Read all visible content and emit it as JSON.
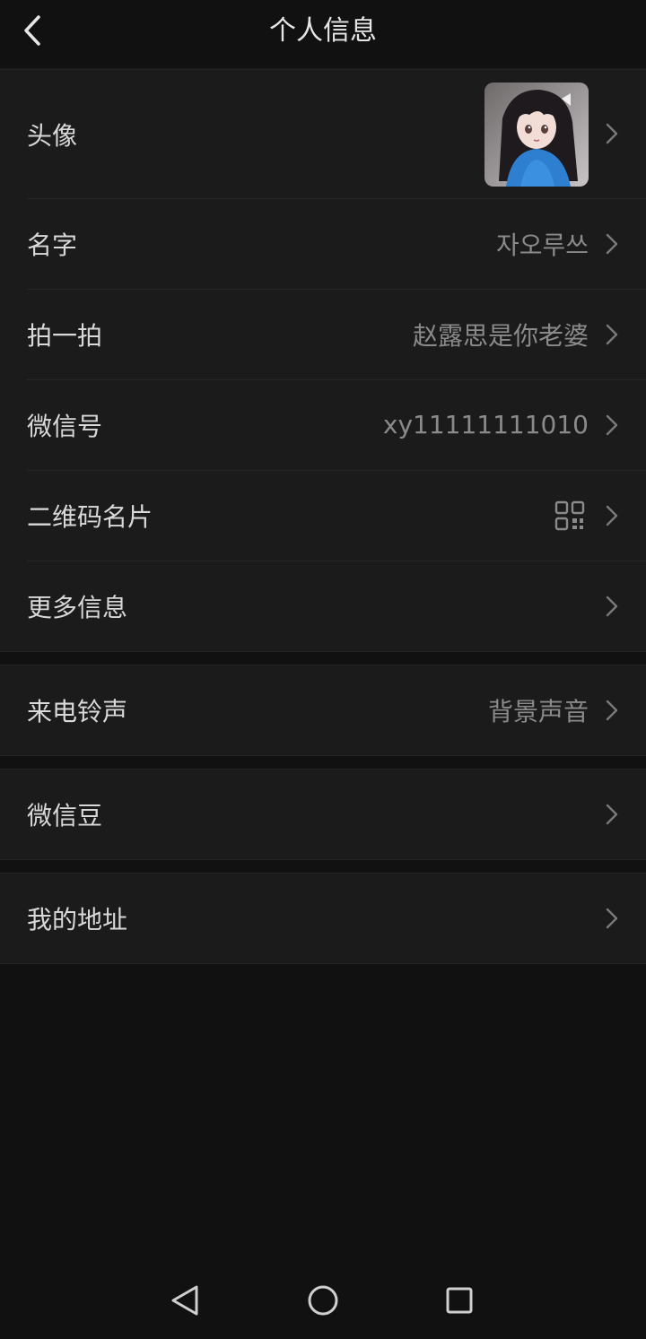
{
  "header": {
    "title": "个人信息",
    "back_icon": "chevron-left-icon"
  },
  "profile": {
    "avatar": {
      "label": "头像",
      "image": "anime-girl-avatar"
    },
    "name": {
      "label": "名字",
      "value": "자오루쓰"
    },
    "pat": {
      "label": "拍一拍",
      "value": "赵露思是你老婆"
    },
    "wechat_id": {
      "label": "微信号",
      "value": "xy11111111010"
    },
    "qr_card": {
      "label": "二维码名片",
      "icon": "qr-code-icon"
    },
    "more_info": {
      "label": "更多信息"
    }
  },
  "ringtone": {
    "label": "来电铃声",
    "value": "背景声音"
  },
  "wechat_beans": {
    "label": "微信豆"
  },
  "my_address": {
    "label": "我的地址"
  },
  "colors": {
    "background": "#111111",
    "row_background": "#1b1b1b",
    "label_text": "#d9d9d9",
    "value_text": "#8a8a8a"
  },
  "navbar": {
    "back_icon": "triangle-back-icon",
    "home_icon": "circle-home-icon",
    "recents_icon": "square-recents-icon"
  }
}
